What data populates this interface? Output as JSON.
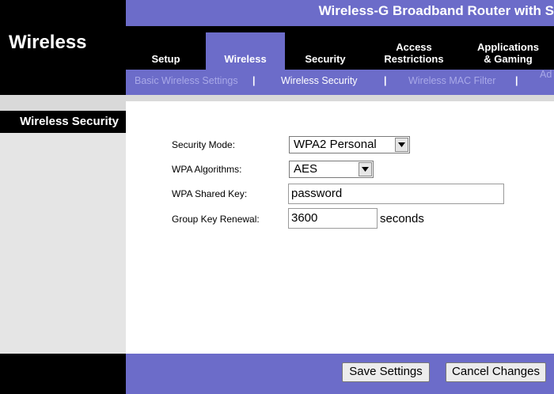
{
  "header": {
    "product": "Wireless-G Broadband Router with S"
  },
  "section": {
    "title": "Wireless",
    "subtitle": "Wireless Security"
  },
  "tabs": [
    {
      "label": "Setup",
      "active": false
    },
    {
      "label": "Wireless",
      "active": true
    },
    {
      "label": "Security",
      "active": false
    },
    {
      "label": "Access Restrictions",
      "active": false
    },
    {
      "label": "Applications & Gaming",
      "active": false
    }
  ],
  "subnav": {
    "items": [
      "Basic Wireless Settings",
      "Wireless Security",
      "Wireless MAC Filter",
      "Ad"
    ],
    "active": "Wireless Security",
    "separator": "|"
  },
  "form": {
    "security_mode_label": "Security Mode:",
    "security_mode_value": "WPA2 Personal",
    "algorithms_label": "WPA Algorithms:",
    "algorithms_value": "AES",
    "shared_key_label": "WPA Shared  Key:",
    "shared_key_value": "password",
    "renewal_label": "Group Key  Renewal:",
    "renewal_value": "3600",
    "renewal_unit": "seconds"
  },
  "footer": {
    "save_label": "Save Settings",
    "cancel_label": "Cancel Changes"
  },
  "colors": {
    "accent": "#6c6cc9",
    "background": "#000000"
  }
}
